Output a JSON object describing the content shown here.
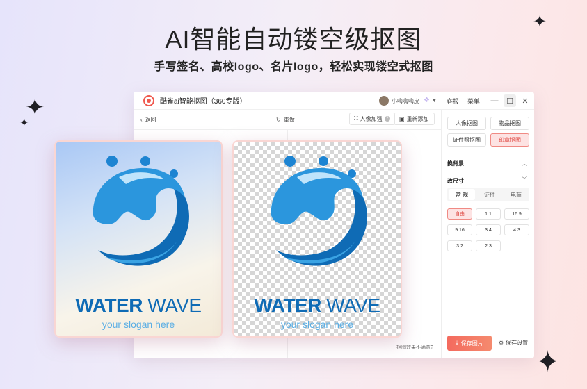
{
  "hero": {
    "headline": "AI智能自动镂空级抠图",
    "subline": "手写签名、高校logo、名片logo，轻松实现镂空式抠图"
  },
  "window": {
    "title": "酷雀ai智能抠图（360专版）",
    "username": "小嗨嗨嗨皮",
    "links": {
      "feedback": "客报",
      "menu": "菜单"
    },
    "controls": {
      "minimize": "—",
      "maximize": "☐",
      "close": "✕"
    }
  },
  "toolbar": {
    "back": "返回",
    "redo": "重做",
    "portrait_enhance": "人像加强",
    "readd": "重新添加"
  },
  "canvas": {
    "unsatisfied": "抠图效果不满意?"
  },
  "sample": {
    "title_bold": "WATER",
    "title_thin": "WAVE",
    "slogan": "your slogan here"
  },
  "panel": {
    "modes": [
      "人像抠图",
      "物品抠图",
      "证件照抠图",
      "印章抠图"
    ],
    "selected_mode": "印章抠图",
    "background_section": "换背景",
    "size_section": "改尺寸",
    "size_tabs": [
      "常 规",
      "证件",
      "电商"
    ],
    "ratios": [
      "自由",
      "1:1",
      "16:9",
      "9:16",
      "3:4",
      "4:3",
      "3:2",
      "2:3"
    ],
    "save_button": "保存图片",
    "save_settings": "保存设置"
  },
  "colors": {
    "accent": "#f05a4f",
    "logo_dark": "#0f6bb5",
    "logo_light": "#3aa3e3"
  }
}
